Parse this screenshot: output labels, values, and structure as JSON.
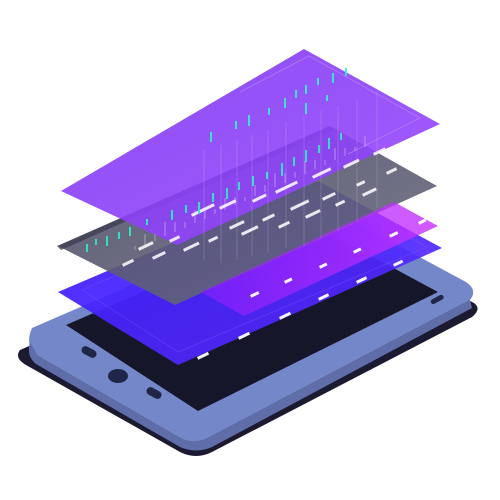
{
  "colors": {
    "background": "#ffffff",
    "device_shadow": "#1c1b33",
    "device_body": "#7285c2",
    "device_body_edge": "#5b6aa8",
    "device_body_light": "#8fa0d6",
    "screen": "#17172e",
    "buttons": "#1f2447",
    "layer_bottom": "#3c22ff",
    "layer_middle_gray": "#55556b",
    "layer_middle_magenta": "#b52aff",
    "layer_top": "#8a3cf8",
    "accent_teal": "#29e6c5",
    "accent_white": "#ffffff"
  },
  "icons": {
    "home_button": "home-button-icon",
    "left_button": "rectangle-button-icon",
    "right_button": "rectangle-button-icon"
  }
}
